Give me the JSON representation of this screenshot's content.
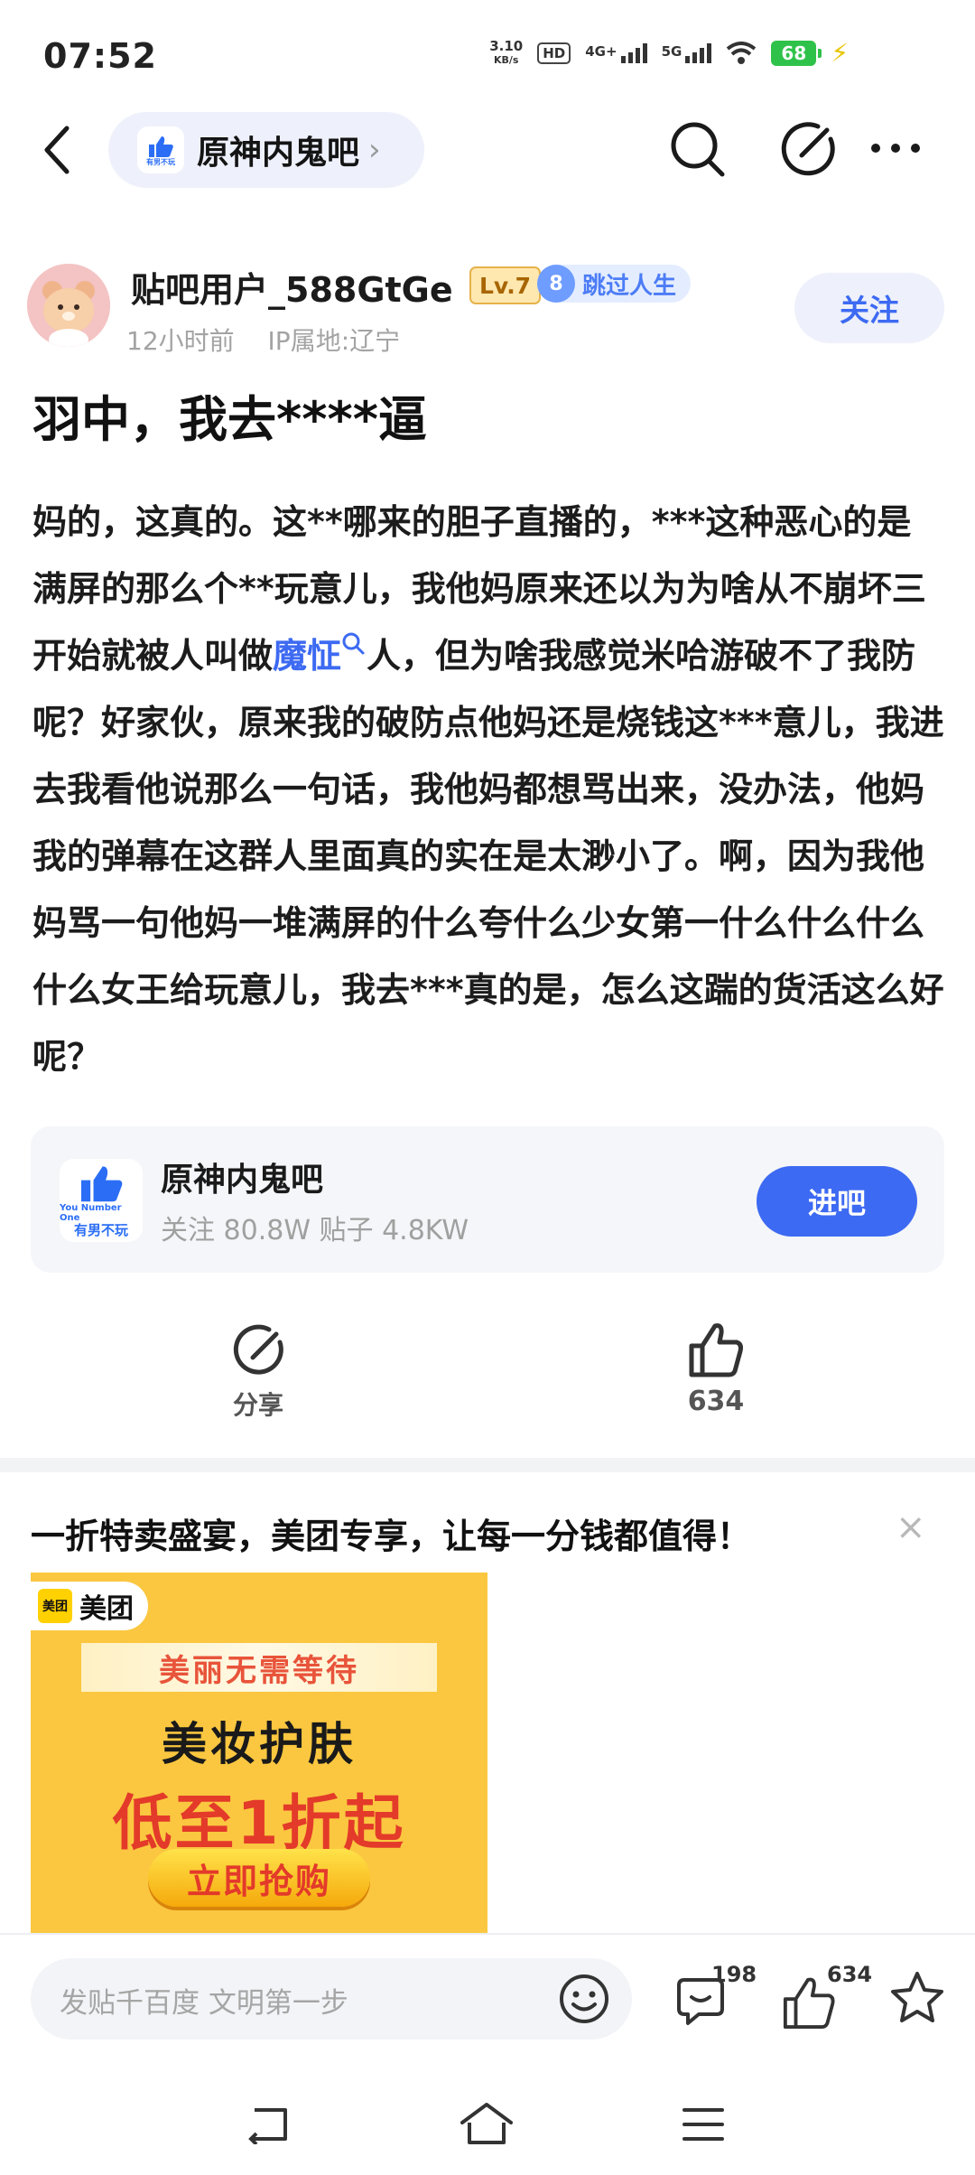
{
  "status": {
    "time": "07:52",
    "speed": "3.10",
    "speed_unit": "KB/s",
    "hd": "HD",
    "network_1": "4G+",
    "network_2": "5G",
    "battery": "68"
  },
  "header": {
    "forum_name": "原神内鬼吧",
    "arrow": "›"
  },
  "post": {
    "username": "贴吧用户_588GtGe",
    "level": "Lv.7",
    "badge_num": "8",
    "badge_text": "跳过人生",
    "time": "12小时前",
    "ip": "IP属地:辽宁",
    "follow": "关注",
    "title": "羽中，我去****逼",
    "body_part1": "妈的，这真的。这**哪来的胆子直播的，***这种恶心的是满屏的那么个**玩意儿，我他妈原来还以为为啥从不崩坏三开始就被人叫做",
    "keyword": "魔怔",
    "body_part2": "人，但为啥我感觉米哈游破不了我防呢？好家伙，原来我的破防点他妈还是烧钱这***意儿，我进去我看他说那么一句话，我他妈都想骂出来，没办法，他妈我的弹幕在这群人里面真的实在是太渺小了。啊，因为我他妈骂一句他妈一堆满屏的什么夸什么少女第一什么什么什么什么女王给玩意儿，我去***真的是，怎么这踹的货活这么好呢？"
  },
  "forum_card": {
    "name": "原神内鬼吧",
    "stats": "关注 80.8W  贴子 4.8KW",
    "enter": "进吧",
    "logo_text": "You Number One",
    "logo_slogan": "有男不玩"
  },
  "actions": {
    "share": "分享",
    "likes": "634"
  },
  "ad": {
    "text": "一折特卖盛宴，美团专享，让每一分钱都值得！",
    "close": "×",
    "brand_logo": "美团",
    "brand": "美团",
    "band": "美丽无需等待",
    "headline": "美妆护肤",
    "promo": "低至1折起",
    "button": "立即抢购"
  },
  "bottom": {
    "placeholder": "发贴千百度 文明第一步",
    "comments": "198",
    "likes": "634"
  },
  "colors": {
    "accent": "#3d6af2",
    "ad_bg": "#fbc740",
    "promo_red": "#e33a2a"
  },
  "icons": [
    "back-icon",
    "search-icon",
    "edit-icon",
    "more-icon",
    "share-icon",
    "like-icon",
    "emoji-icon",
    "comment-icon",
    "star-icon",
    "nav-back-icon",
    "nav-home-icon",
    "nav-menu-icon"
  ]
}
